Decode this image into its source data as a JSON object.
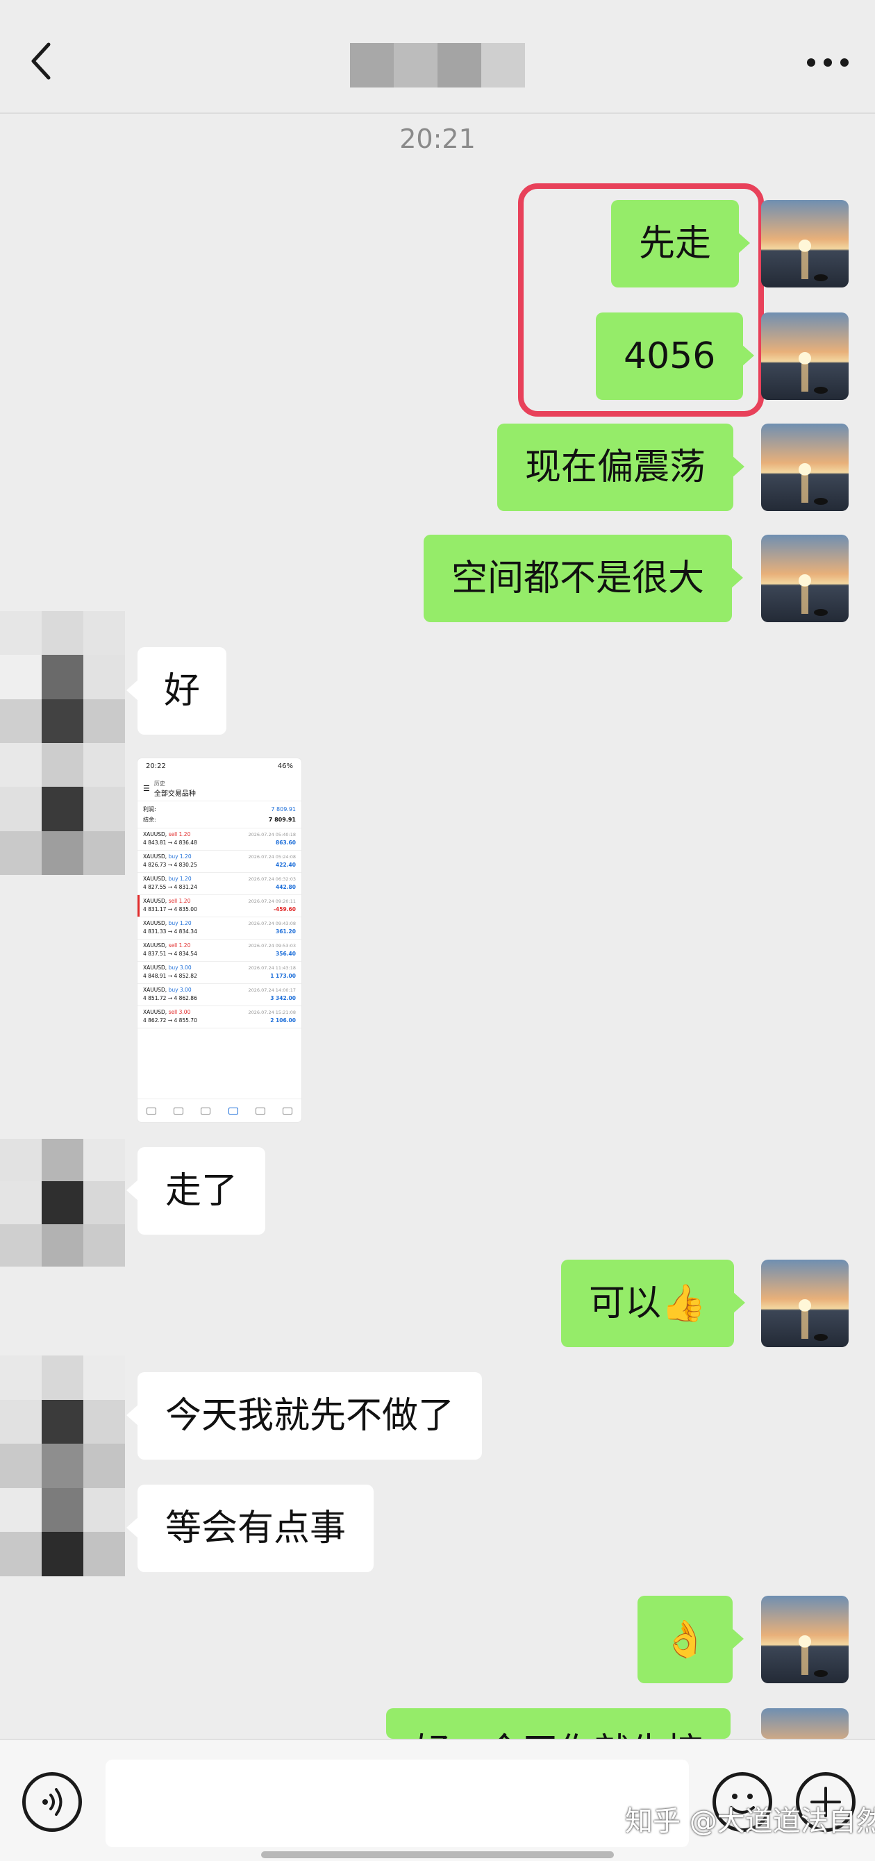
{
  "timestamp": "20:21",
  "messages": {
    "m1": "先走",
    "m2": "4056",
    "m3": "现在偏震荡",
    "m4": "空间都不是很大",
    "m5": "好",
    "m6": "走了",
    "m7": "可以👍",
    "m8": "今天我就先不做了",
    "m9": "等会有点事",
    "m10": "👌",
    "m11": "好，今天你就先控"
  },
  "screenshot": {
    "status_time": "20:22",
    "status_icons": "46%",
    "header_small": "历史",
    "header_title": "全部交易品种",
    "profit_label": "利润:",
    "profit_value": "7 809.91",
    "balance_label": "结余:",
    "balance_value": "7 809.91",
    "trades": [
      {
        "symbol": "XAUUSD,",
        "side": "sell 1.20",
        "prices": "4 843.81 → 4 836.48",
        "date": "2026.07.24 05:40:18",
        "profit": "863.60"
      },
      {
        "symbol": "XAUUSD,",
        "side": "buy 1.20",
        "prices": "4 826.73 → 4 830.25",
        "date": "2026.07.24 05:24:08",
        "profit": "422.40"
      },
      {
        "symbol": "XAUUSD,",
        "side": "buy 1.20",
        "prices": "4 827.55 → 4 831.24",
        "date": "2026.07.24 06:32:03",
        "profit": "442.80"
      },
      {
        "symbol": "XAUUSD,",
        "side": "sell 1.20",
        "prices": "4 831.17 → 4 835.00",
        "date": "2026.07.24 09:20:11",
        "profit": "-459.60"
      },
      {
        "symbol": "XAUUSD,",
        "side": "buy 1.20",
        "prices": "4 831.33 → 4 834.34",
        "date": "2026.07.24 09:43:08",
        "profit": "361.20"
      },
      {
        "symbol": "XAUUSD,",
        "side": "sell 1.20",
        "prices": "4 837.51 → 4 834.54",
        "date": "2026.07.24 09:53:03",
        "profit": "356.40"
      },
      {
        "symbol": "XAUUSD,",
        "side": "buy 3.00",
        "prices": "4 848.91 → 4 852.82",
        "date": "2026.07.24 11:43:18",
        "profit": "1 173.00"
      },
      {
        "symbol": "XAUUSD,",
        "side": "buy 3.00",
        "prices": "4 851.72 → 4 862.86",
        "date": "2026.07.24 14:00:17",
        "profit": "3 342.00"
      },
      {
        "symbol": "XAUUSD,",
        "side": "sell 3.00",
        "prices": "4 862.72 → 4 855.70",
        "date": "2026.07.24 15:21:08",
        "profit": "2 106.00"
      }
    ]
  },
  "watermark": "知乎 @大道道法自然",
  "colors": {
    "bubble_green": "#95ec69",
    "highlight": "#e8415a",
    "background": "#ededed"
  },
  "icons": {
    "back": "chevron-left-icon",
    "more": "more-dots-icon",
    "voice": "voice-icon",
    "emoji": "emoji-icon",
    "plus": "plus-icon"
  }
}
